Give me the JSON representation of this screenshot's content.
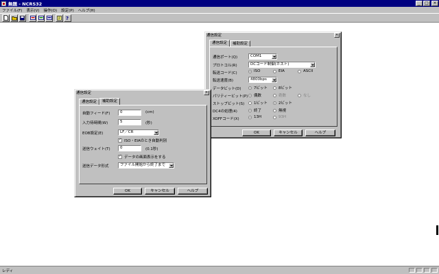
{
  "app": {
    "title": "無題 - NCRS32",
    "window_buttons": [
      "_",
      "□",
      "×"
    ]
  },
  "menu": [
    "ファイル(F)",
    "表示(V)",
    "操作(O)",
    "設定(P)",
    "ヘルプ(H)"
  ],
  "toolbar": {
    "icons": [
      "new-file-icon",
      "open-folder-icon",
      "save-icon",
      "send-icon",
      "receive-icon",
      "monitor-icon",
      "settings-icon",
      "help-icon"
    ]
  },
  "status": {
    "text": "レディ"
  },
  "comm_dialog": {
    "title": "通信設定",
    "close": "×",
    "tabs": [
      "通信設定",
      "補助設定"
    ],
    "fields": {
      "port_label": "通信ポート(Q)",
      "port_value": "COM1",
      "protocol_label": "プロトコル(R)",
      "protocol_value": "DCコード制御(ホスト)",
      "code_label": "転送コード(C)",
      "code_options": [
        "ISO",
        "EIA",
        "ASCII"
      ],
      "speed_label": "転送速度(B)",
      "speed_value": "4800bps",
      "databit_label": "データビット(D)",
      "databit_options": [
        "7ビット",
        "8ビット"
      ],
      "parity_label": "パリティービット(P)",
      "parity_options": [
        "偶数",
        "奇数",
        "なし"
      ],
      "stopbit_label": "ストップビット(S)",
      "stopbit_options": [
        "1ビット",
        "2ビット"
      ],
      "dc4_label": "DC4の処理(4)",
      "dc4_options": [
        "終了",
        "無視"
      ],
      "xoff_label": "XOFFコード(X)",
      "xoff_options": [
        "13H",
        "93H"
      ]
    },
    "buttons": [
      "OK",
      "キャンセル",
      "ヘルプ"
    ]
  },
  "aux_dialog": {
    "title": "通信設定",
    "close": "×",
    "tabs": [
      "通信設定",
      "補助設定"
    ],
    "fields": {
      "autofeed_label": "自動フィード(F)",
      "autofeed_value": "0",
      "autofeed_unit": "(cm)",
      "timeout_label": "入力待時間(W)",
      "timeout_value": "5",
      "timeout_unit": "(秒)",
      "eob_label": "EOB設定(E)",
      "eob_value": "LF／CR",
      "iso_eia_check": "ISO・EIAのとき自動判別",
      "send_wait_label": "送信ウェイト(T)",
      "send_wait_value": "0",
      "send_wait_unit": "(0.1秒)",
      "screen_show_check": "データの画面表示をする",
      "send_format_label": "送信データ形式",
      "send_format_value": "ファイル開始から終了まで"
    },
    "buttons": [
      "OK",
      "キャンセル",
      "ヘルプ"
    ]
  }
}
